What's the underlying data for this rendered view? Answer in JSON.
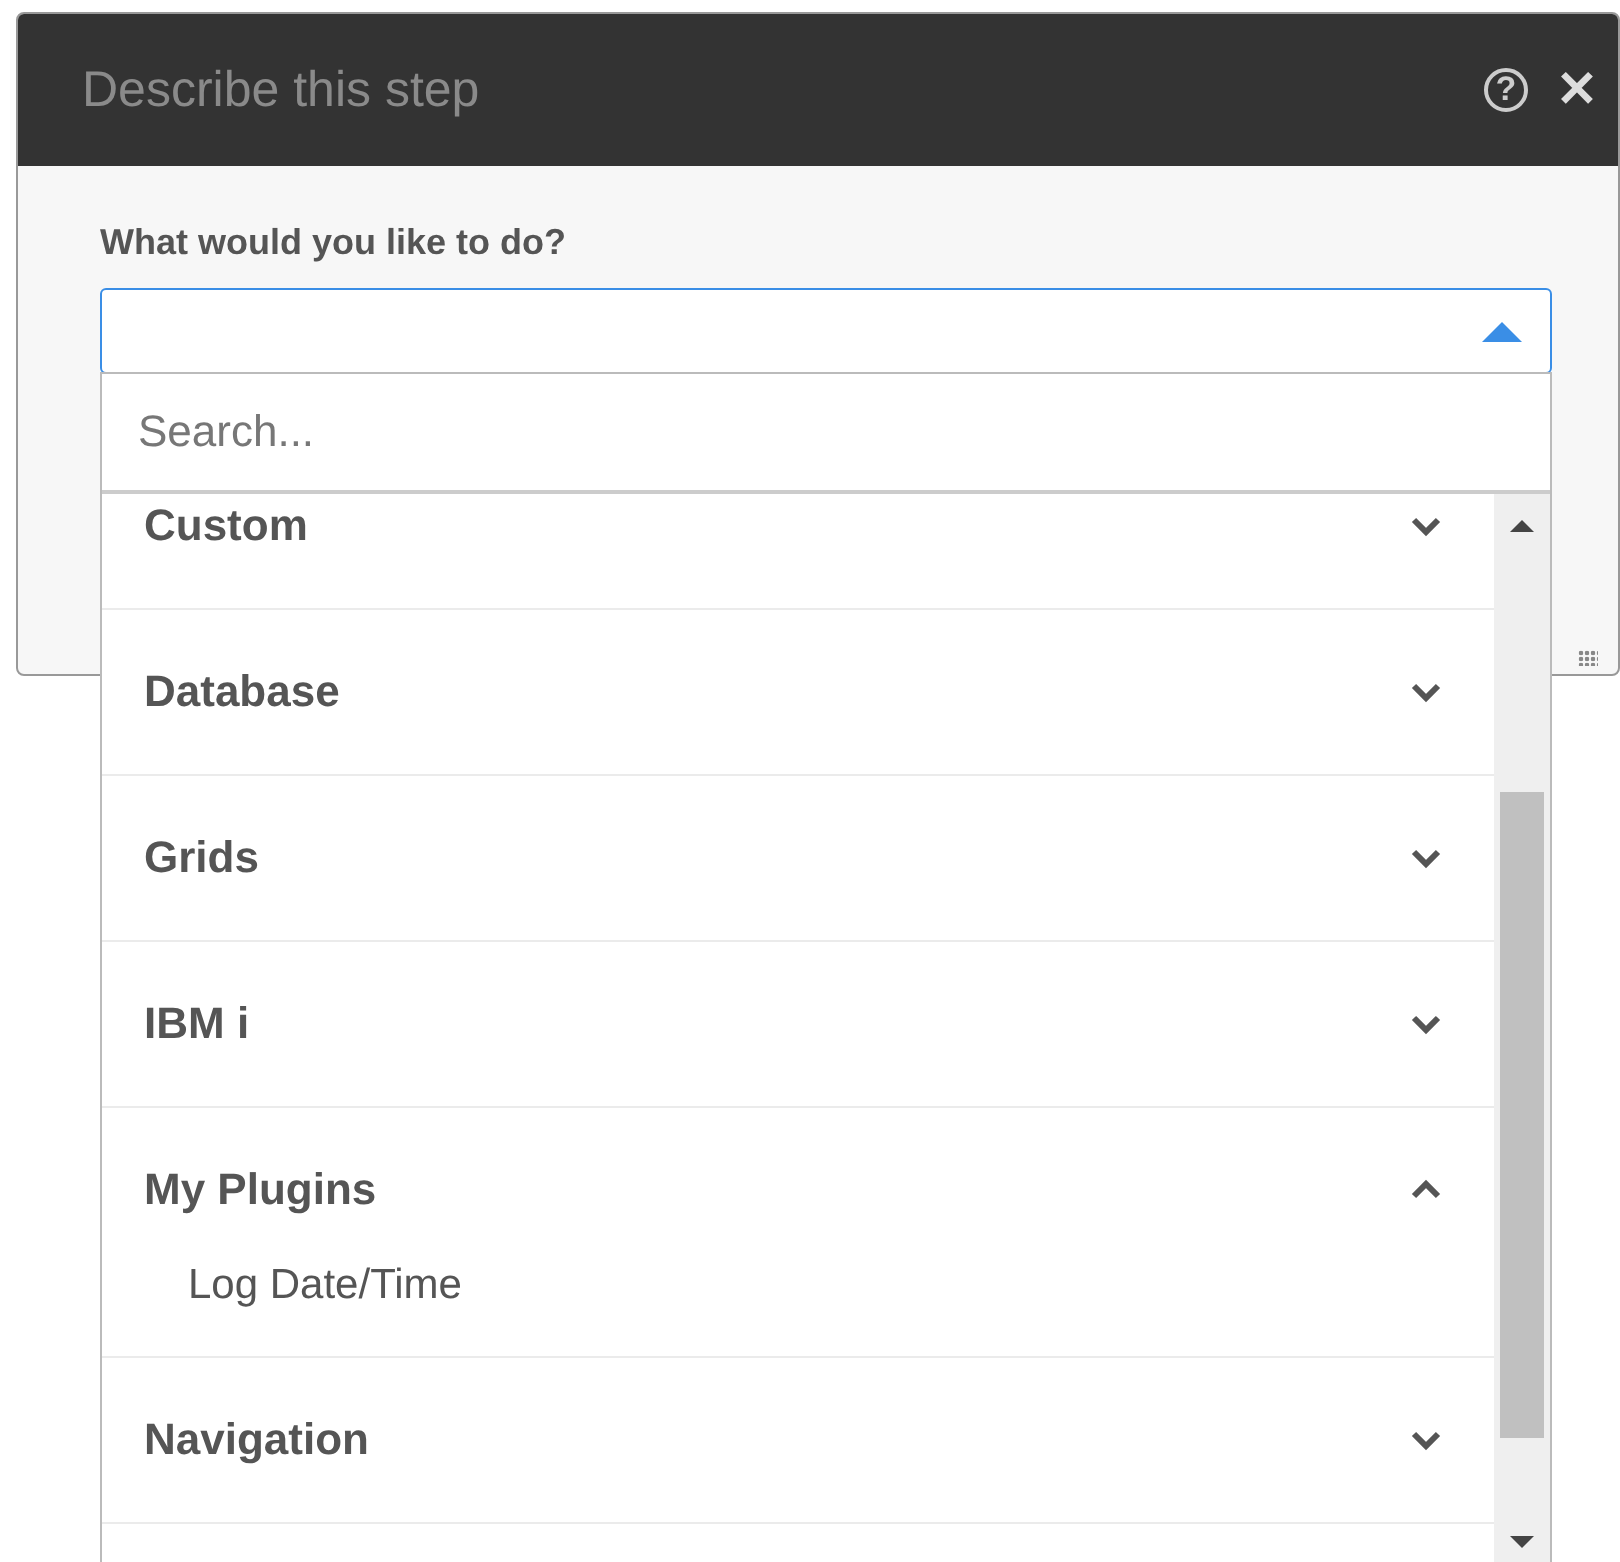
{
  "dialog": {
    "title": "Describe this step",
    "help_icon": "?",
    "close_icon": "✕"
  },
  "field": {
    "label": "What would you like to do?",
    "expanded": true
  },
  "dropdown": {
    "search": {
      "placeholder": "Search..."
    },
    "groups": [
      {
        "label": "Custom",
        "expanded": false
      },
      {
        "label": "Database",
        "expanded": false
      },
      {
        "label": "Grids",
        "expanded": false
      },
      {
        "label": "IBM i",
        "expanded": false
      },
      {
        "label": "My Plugins",
        "expanded": true,
        "children": [
          "Log Date/Time"
        ]
      },
      {
        "label": "Navigation",
        "expanded": false
      }
    ]
  }
}
